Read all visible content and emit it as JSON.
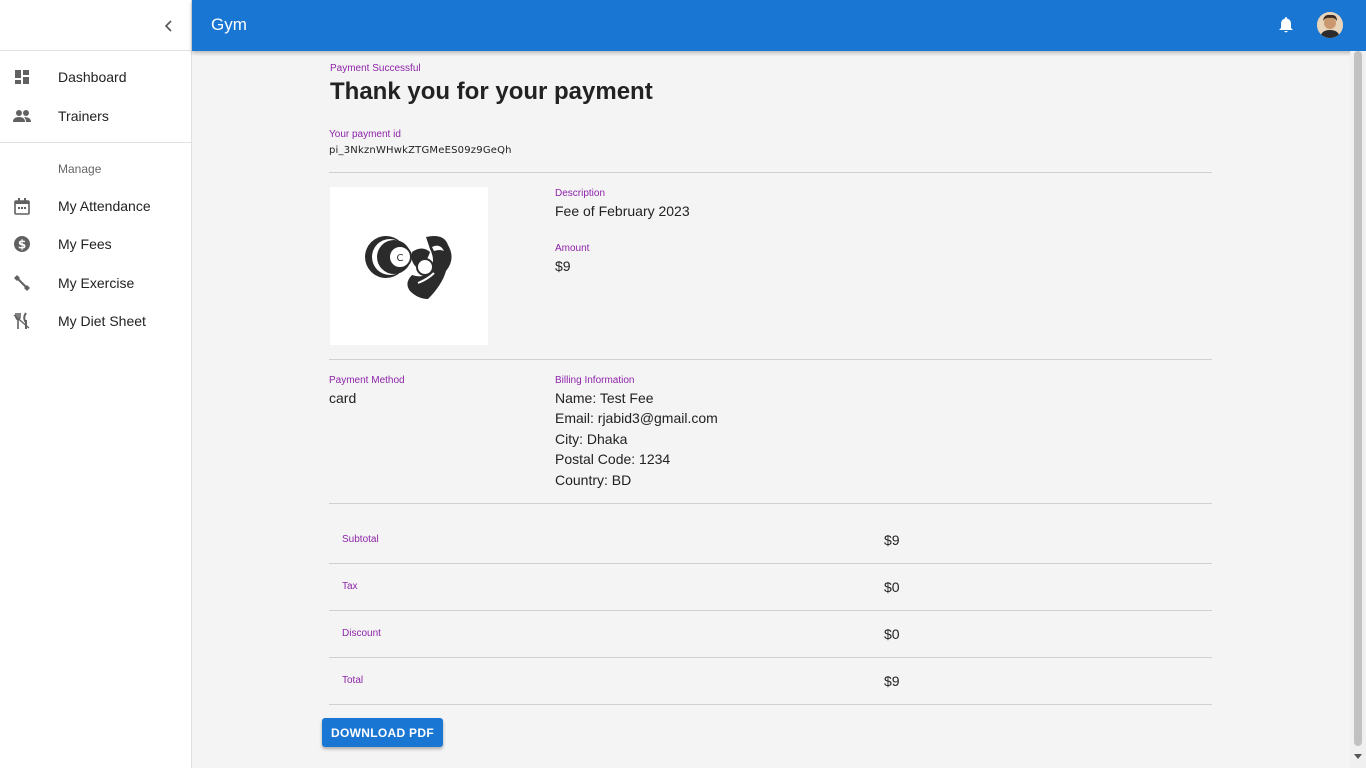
{
  "app": {
    "title": "Gym"
  },
  "sidebar": {
    "items": [
      {
        "label": "Dashboard",
        "icon": "dashboard-icon"
      },
      {
        "label": "Trainers",
        "icon": "people-icon"
      }
    ],
    "section_label": "Manage",
    "manage_items": [
      {
        "label": "My Attendance",
        "icon": "calendar-icon"
      },
      {
        "label": "My Fees",
        "icon": "dollar-circle-icon"
      },
      {
        "label": "My Exercise",
        "icon": "fitness-icon"
      },
      {
        "label": "My Diet Sheet",
        "icon": "restaurant-icon"
      }
    ]
  },
  "payment": {
    "status_label": "Payment Successful",
    "title": "Thank you for your payment",
    "id_label": "Your payment id",
    "id_value": "pi_3NkznWHwkZTGMeES09z9GeQh",
    "description_label": "Description",
    "description_value": "Fee of February 2023",
    "amount_label": "Amount",
    "amount_value": "$9",
    "method_label": "Payment Method",
    "method_value": "card",
    "billing_label": "Billing Information",
    "billing": {
      "name": "Name: Test Fee",
      "email": "Email: rjabid3@gmail.com",
      "city": "City: Dhaka",
      "postal": "Postal Code: 1234",
      "country": "Country: BD"
    },
    "summary": [
      {
        "label": "Subtotal",
        "value": "$9"
      },
      {
        "label": "Tax",
        "value": "$0"
      },
      {
        "label": "Discount",
        "value": "$0"
      },
      {
        "label": "Total",
        "value": "$9"
      }
    ],
    "download_label": "DOWNLOAD PDF"
  },
  "colors": {
    "primary": "#1976d2",
    "accent_text": "#8e24aa",
    "background": "#f4f4f4"
  }
}
